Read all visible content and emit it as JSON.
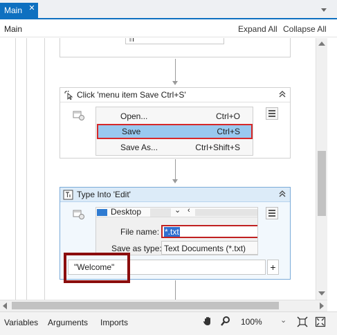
{
  "tab": {
    "title": "Main",
    "close_glyph": "✕"
  },
  "breadcrumb": {
    "label": "Main",
    "expand_all": "Expand All",
    "collapse_all": "Collapse All"
  },
  "click_activity": {
    "title": "Click 'menu item  Save Ctrl+S'",
    "icon": "click-pointer-icon",
    "menu_items": [
      {
        "label": "Open...",
        "shortcut": "Ctrl+O",
        "selected": false
      },
      {
        "label": "Save",
        "shortcut": "Ctrl+S",
        "selected": true
      },
      {
        "label": "Save As...",
        "shortcut": "Ctrl+Shift+S",
        "selected": false
      }
    ]
  },
  "type_activity": {
    "title": "Type Into 'Edit'",
    "icon": "type-into-icon",
    "folder_label": "Desktop",
    "file_name_label": "File name:",
    "file_name_value": "*.txt",
    "save_as_type_label": "Save as type:",
    "save_as_type_value": "Text Documents (*.txt)",
    "text_value": "\"Welcome\"",
    "add_glyph": "+"
  },
  "bottom": {
    "variables": "Variables",
    "arguments": "Arguments",
    "imports": "Imports",
    "zoom": "100%"
  },
  "colors": {
    "accent": "#0e70c0",
    "selection": "#99c9ef",
    "highlight_red": "#d62828",
    "annotation_box": "#8b0d0d",
    "selected_card_bg": "#f2f8fd",
    "selected_card_border": "#7aaad8"
  }
}
